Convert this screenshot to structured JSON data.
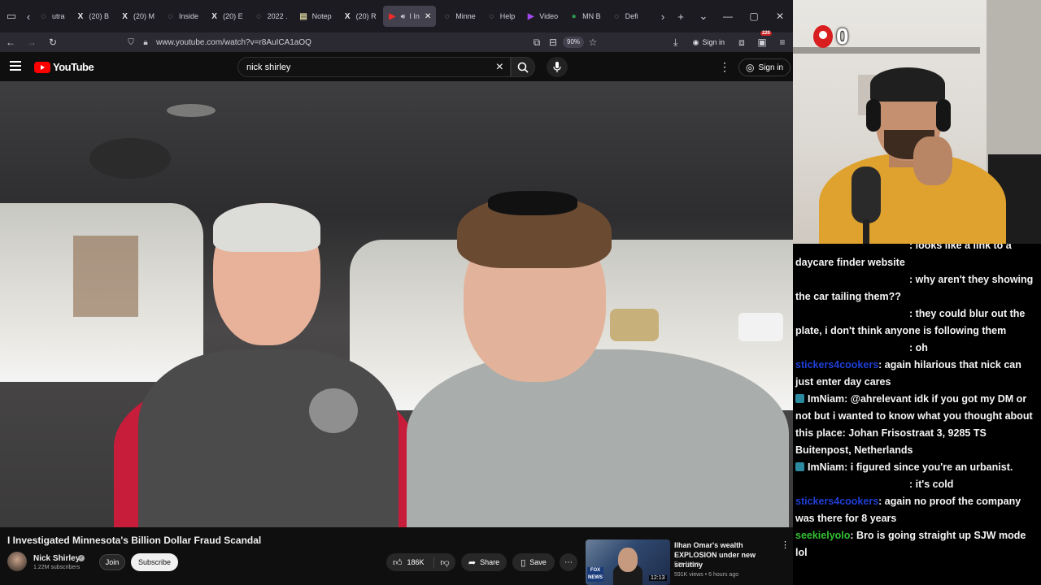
{
  "browser": {
    "tabs": [
      {
        "label": "utra",
        "icon": "generic-tab-icon"
      },
      {
        "label": "(20) B",
        "icon": "x-logo-icon"
      },
      {
        "label": "(20) M",
        "icon": "x-logo-icon"
      },
      {
        "label": "Inside",
        "icon": "generic-tab-icon"
      },
      {
        "label": "(20) E",
        "icon": "x-logo-icon"
      },
      {
        "label": "2022 .",
        "icon": "generic-tab-icon"
      },
      {
        "label": "Notep",
        "icon": "notepad-icon"
      },
      {
        "label": "(20) R",
        "icon": "x-logo-icon"
      },
      {
        "label": "I In",
        "icon": "youtube-icon",
        "active": true
      },
      {
        "label": "Minne",
        "icon": "generic-tab-icon"
      },
      {
        "label": "Help",
        "icon": "generic-tab-icon"
      },
      {
        "label": "Video",
        "icon": "video-icon"
      },
      {
        "label": "MN B",
        "icon": "map-pin-icon"
      },
      {
        "label": "Defi",
        "icon": "generic-tab-icon"
      }
    ],
    "url": "www.youtube.com/watch?v=r8AuICA1aOQ",
    "zoom": "90%",
    "sign_in": "Sign in",
    "ext_badge": "220"
  },
  "youtube": {
    "logo_text": "YouTube",
    "search": {
      "value": "nick shirley",
      "placeholder": "Search"
    },
    "sign_in": "Sign in",
    "video": {
      "title": "I Investigated Minnesota's Billion Dollar Fraud Scandal",
      "channel": "Nick Shirley",
      "subscribers": "1.22M subscribers",
      "join": "Join",
      "subscribe": "Subscribe",
      "likes": "186K",
      "share": "Share",
      "save": "Save"
    },
    "recommendation": {
      "title": "Ilhan Omar's wealth EXPLOSION under new scrutiny",
      "channel": "Fox News",
      "meta": "591K views • 6 hours ago",
      "duration": "12:13",
      "thumb_badge": "FOX NEWS"
    }
  },
  "stream": {
    "counter": "0",
    "chat": [
      {
        "user": "",
        "user_color": "blue",
        "prefix_blank": true,
        "text": ": looks like a link to a daycare finder website"
      },
      {
        "user": "",
        "user_color": "blue",
        "prefix_blank": true,
        "text": ": why aren't they showing the car tailing them??"
      },
      {
        "user": "",
        "user_color": "blue",
        "prefix_blank": true,
        "text": ": they could blur out the plate, i don't think anyone is following them"
      },
      {
        "user": "",
        "user_color": "blue",
        "prefix_blank": true,
        "text": ": oh"
      },
      {
        "user": "stickers4cookers",
        "user_color": "blue",
        "text": ": again hilarious that nick can just enter day cares"
      },
      {
        "user": "ImNiam",
        "user_color": "white",
        "badge": true,
        "text": ": @ahrelevant idk if you got my DM or not but i wanted to know what you thought about this place: Johan Frisostraat 3, 9285 TS Buitenpost, Netherlands"
      },
      {
        "user": "ImNiam",
        "user_color": "white",
        "badge": true,
        "text": ": i figured since you're an urbanist."
      },
      {
        "user": "",
        "user_color": "blue",
        "prefix_blank": true,
        "text": ": it's cold"
      },
      {
        "user": "stickers4cookers",
        "user_color": "blue",
        "text": ": again no proof the company was there for 8 years"
      },
      {
        "user": "seekielyolo",
        "user_color": "green",
        "text": ": Bro is going straight up SJW mode lol"
      }
    ]
  }
}
